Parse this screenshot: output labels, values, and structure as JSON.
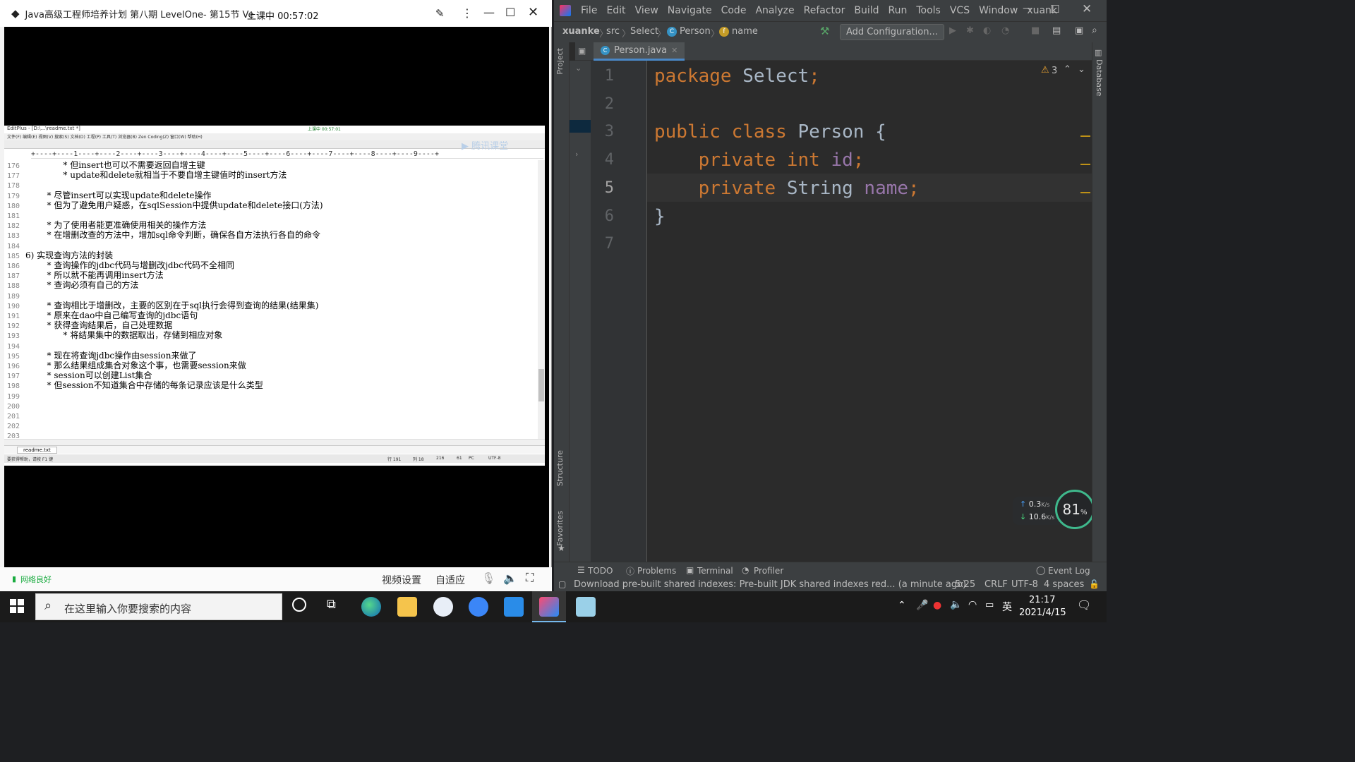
{
  "player": {
    "title": "Java高级工程师培养计划 第八期 LevelOne- 第15节 Ve",
    "live_badge": "上课中 00:57:02",
    "network_status": "网络良好",
    "controls": {
      "video_settings": "视频设置",
      "adapt": "自适应"
    }
  },
  "editplus": {
    "title": "EditPlus - [D:\\...\\readme.txt *]",
    "ruler": "+----+----1----+----2----+----3----+----4----+----5----+----6----+----7----+----8----+----9----+",
    "tab_label": "readme.txt",
    "status_left": "要获得帮助，请按 F1 键",
    "status_right": [
      "行 191",
      "列 18",
      "216",
      "61",
      "PC",
      "UTF-8"
    ],
    "mini_badge": "上课中 00:57:01",
    "watermark": "腾讯课堂",
    "lines": [
      {
        "n": "176",
        "t": "              * 但insert也可以不需要返回自增主键"
      },
      {
        "n": "177",
        "t": "              * update和delete就相当于不要自增主键值时的insert方法"
      },
      {
        "n": "178",
        "t": ""
      },
      {
        "n": "179",
        "t": "        * 尽管insert可以实现update和delete操作"
      },
      {
        "n": "180",
        "t": "        * 但为了避免用户疑惑，在sqlSession中提供update和delete接口(方法)"
      },
      {
        "n": "181",
        "t": ""
      },
      {
        "n": "182",
        "t": "        * 为了使用者能更准确使用相关的操作方法"
      },
      {
        "n": "183",
        "t": "        * 在增删改查的方法中，增加sql命令判断，确保各自方法执行各自的命令"
      },
      {
        "n": "184",
        "t": ""
      },
      {
        "n": "185",
        "t": "6) 实现查询方法的封装"
      },
      {
        "n": "186",
        "t": "        * 查询操作的jdbc代码与增删改jdbc代码不全相同"
      },
      {
        "n": "187",
        "t": "        * 所以就不能再调用insert方法"
      },
      {
        "n": "188",
        "t": "        * 查询必须有自己的方法"
      },
      {
        "n": "189",
        "t": ""
      },
      {
        "n": "190",
        "t": "        * 查询相比于增删改，主要的区别在于sql执行会得到查询的结果(结果集)"
      },
      {
        "n": "191",
        "t": "        * 原来在dao中自己编写查询的jdbc语句"
      },
      {
        "n": "192",
        "t": "        * 获得查询结果后，自己处理数据"
      },
      {
        "n": "193",
        "t": "              * 将结果集中的数据取出，存储到相应对象"
      },
      {
        "n": "194",
        "t": ""
      },
      {
        "n": "195",
        "t": "        * 现在将查询jdbc操作由session来做了"
      },
      {
        "n": "196",
        "t": "        * 那么结果组成集合对象这个事，也需要session来做"
      },
      {
        "n": "197",
        "t": "        * session可以创建List集合"
      },
      {
        "n": "198",
        "t": "        * 但session不知道集合中存储的每条记录应该是什么类型"
      },
      {
        "n": "199",
        "t": ""
      },
      {
        "n": "200",
        "t": ""
      },
      {
        "n": "201",
        "t": ""
      },
      {
        "n": "202",
        "t": ""
      },
      {
        "n": "203",
        "t": ""
      }
    ]
  },
  "ide": {
    "menu": [
      "File",
      "Edit",
      "View",
      "Navigate",
      "Code",
      "Analyze",
      "Refactor",
      "Build",
      "Run",
      "Tools",
      "VCS",
      "Window",
      "xuank"
    ],
    "breadcrumb": [
      "xuanke",
      "src",
      "Select",
      "Person",
      "name"
    ],
    "add_configuration": "Add Configuration...",
    "tab": "Person.java",
    "side_labels": {
      "project": "Project",
      "structure": "Structure",
      "favorites": "Favorites",
      "database": "Database"
    },
    "warnings": "3",
    "code": [
      {
        "n": "1",
        "parts": [
          [
            "kw",
            "package "
          ],
          [
            "id",
            "Select"
          ],
          [
            "kw",
            ";"
          ]
        ]
      },
      {
        "n": "2",
        "parts": []
      },
      {
        "n": "3",
        "parts": [
          [
            "kw",
            "public class "
          ],
          [
            "id",
            "Person "
          ],
          [
            "id",
            "{"
          ]
        ]
      },
      {
        "n": "4",
        "parts": [
          [
            "kw",
            "    private int "
          ],
          [
            "fld",
            "id"
          ],
          [
            "kw",
            ";"
          ]
        ]
      },
      {
        "n": "5",
        "parts": [
          [
            "kw",
            "    private "
          ],
          [
            "id",
            "String "
          ],
          [
            "fld",
            "name"
          ],
          [
            "kw",
            ";"
          ]
        ]
      },
      {
        "n": "6",
        "parts": [
          [
            "id",
            "}"
          ]
        ]
      },
      {
        "n": "7",
        "parts": []
      }
    ],
    "toolwindows": [
      "TODO",
      "Problems",
      "Terminal",
      "Profiler"
    ],
    "event_log": "Event Log",
    "status_message": "Download pre-built shared indexes: Pre-built JDK shared indexes red... (a minute ago)",
    "status_right": [
      "5:25",
      "CRLF",
      "UTF-8",
      "4 spaces"
    ],
    "net_widget": {
      "up": "0.3",
      "down": "10.6",
      "unit": "K/s",
      "percent": "81",
      "percent_sign": "%"
    }
  },
  "taskbar": {
    "search_placeholder": "在这里输入你要搜索的内容",
    "time": "21:17",
    "date": "2021/4/15",
    "ime": "英"
  },
  "colors": {
    "keyword": "#cc7832",
    "identifier": "#a9b7c6",
    "field": "#9876aa"
  }
}
